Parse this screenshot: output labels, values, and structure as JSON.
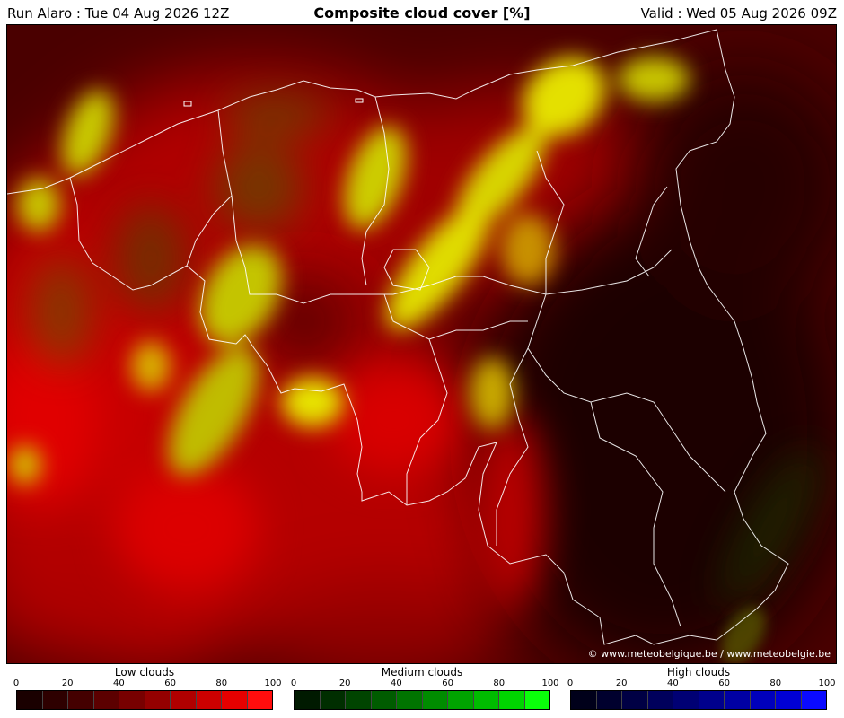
{
  "header": {
    "run": "Run Alaro : Tue 04 Aug 2026 12Z",
    "title": "Composite cloud cover [%]",
    "valid": "Valid : Wed 05 Aug 2026 09Z"
  },
  "map": {
    "credit": "© www.meteobelgique.be / www.meteobelgie.be"
  },
  "legends": [
    {
      "title": "Low clouds",
      "ticks": [
        "0",
        "20",
        "40",
        "60",
        "80",
        "100"
      ],
      "colors": [
        "#1a0000",
        "#2e0000",
        "#440000",
        "#5c0000",
        "#780000",
        "#940000",
        "#b00000",
        "#cc0000",
        "#e60000",
        "#ff0d0d"
      ]
    },
    {
      "title": "Medium clouds",
      "ticks": [
        "0",
        "20",
        "40",
        "60",
        "80",
        "100"
      ],
      "colors": [
        "#001a00",
        "#002e00",
        "#004400",
        "#005c00",
        "#007400",
        "#008c00",
        "#00a400",
        "#00bc00",
        "#00d400",
        "#0aff0a"
      ]
    },
    {
      "title": "High clouds",
      "ticks": [
        "0",
        "20",
        "40",
        "60",
        "80",
        "100"
      ],
      "colors": [
        "#00001a",
        "#00002e",
        "#000044",
        "#00005c",
        "#000074",
        "#00008c",
        "#0000a4",
        "#0000bc",
        "#0000d4",
        "#0a0aff"
      ]
    }
  ]
}
